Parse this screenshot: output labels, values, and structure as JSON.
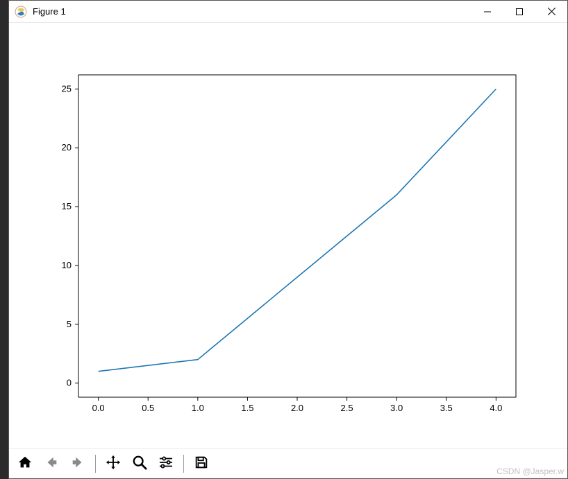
{
  "window": {
    "title": "Figure 1"
  },
  "toolbar": {
    "home": "Home",
    "back": "Back",
    "forward": "Forward",
    "pan": "Pan",
    "zoom": "Zoom",
    "configure": "Configure subplots",
    "save": "Save"
  },
  "watermark": "CSDN @Jasper.w",
  "chart_data": {
    "type": "line",
    "x": [
      0,
      1,
      2,
      3,
      4
    ],
    "y": [
      1,
      2,
      9,
      16,
      25
    ],
    "x_ticks": [
      "0.0",
      "0.5",
      "1.0",
      "1.5",
      "2.0",
      "2.5",
      "3.0",
      "3.5",
      "4.0"
    ],
    "x_tick_vals": [
      0.0,
      0.5,
      1.0,
      1.5,
      2.0,
      2.5,
      3.0,
      3.5,
      4.0
    ],
    "y_ticks": [
      "0",
      "5",
      "10",
      "15",
      "20",
      "25"
    ],
    "y_tick_vals": [
      0,
      5,
      10,
      15,
      20,
      25
    ],
    "xlim": [
      -0.2,
      4.2
    ],
    "ylim": [
      -1.2,
      26.2
    ],
    "line_color": "#1f77b4"
  }
}
